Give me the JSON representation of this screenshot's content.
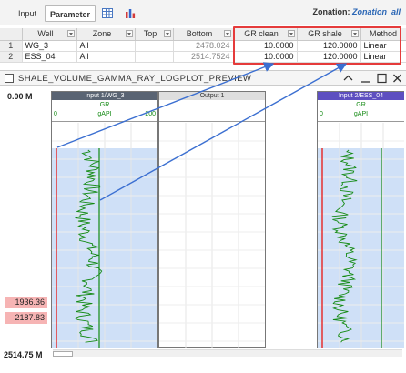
{
  "toolbar": {
    "tabs": [
      "Input",
      "Parameter"
    ],
    "zonation_label": "Zonation:",
    "zonation_value": "Zonation_all"
  },
  "table": {
    "headers": [
      "Well",
      "Zone",
      "Top",
      "Bottom",
      "GR clean",
      "GR shale",
      "Method"
    ],
    "rows": [
      {
        "idx": "1",
        "well": "WG_3",
        "zone": "All",
        "top": "",
        "bottom": "2478.024",
        "gr_clean": "10.0000",
        "gr_shale": "120.0000",
        "method": "Linear"
      },
      {
        "idx": "2",
        "well": "ESS_04",
        "zone": "All",
        "top": "",
        "bottom": "2514.7524",
        "gr_clean": "10.0000",
        "gr_shale": "120.0000",
        "method": "Linear"
      }
    ]
  },
  "window": {
    "title": "SHALE_VOLUME_GAMMA_RAY_LOGPLOT_PREVIEW",
    "depth_top": "0.00 M",
    "depth_bottom": "2514.75 M",
    "markers": [
      "1936.36",
      "2187.83"
    ]
  },
  "tracks": [
    {
      "header": "Input 1/WG_3",
      "curve": "GR",
      "min": "0",
      "max": "200",
      "unit": "gAPI"
    },
    {
      "header": "Output 1"
    },
    {
      "header": "Input 2/ESS_04",
      "curve": "GR",
      "min": "0",
      "unit": "gAPI"
    }
  ],
  "colors": {
    "accent_red": "#e53b3b",
    "curve_green": "#138a13",
    "fill_blue": "#cfe0f7",
    "arrow_blue": "#3b6fd1",
    "marker_pink": "#f6b4b4"
  }
}
